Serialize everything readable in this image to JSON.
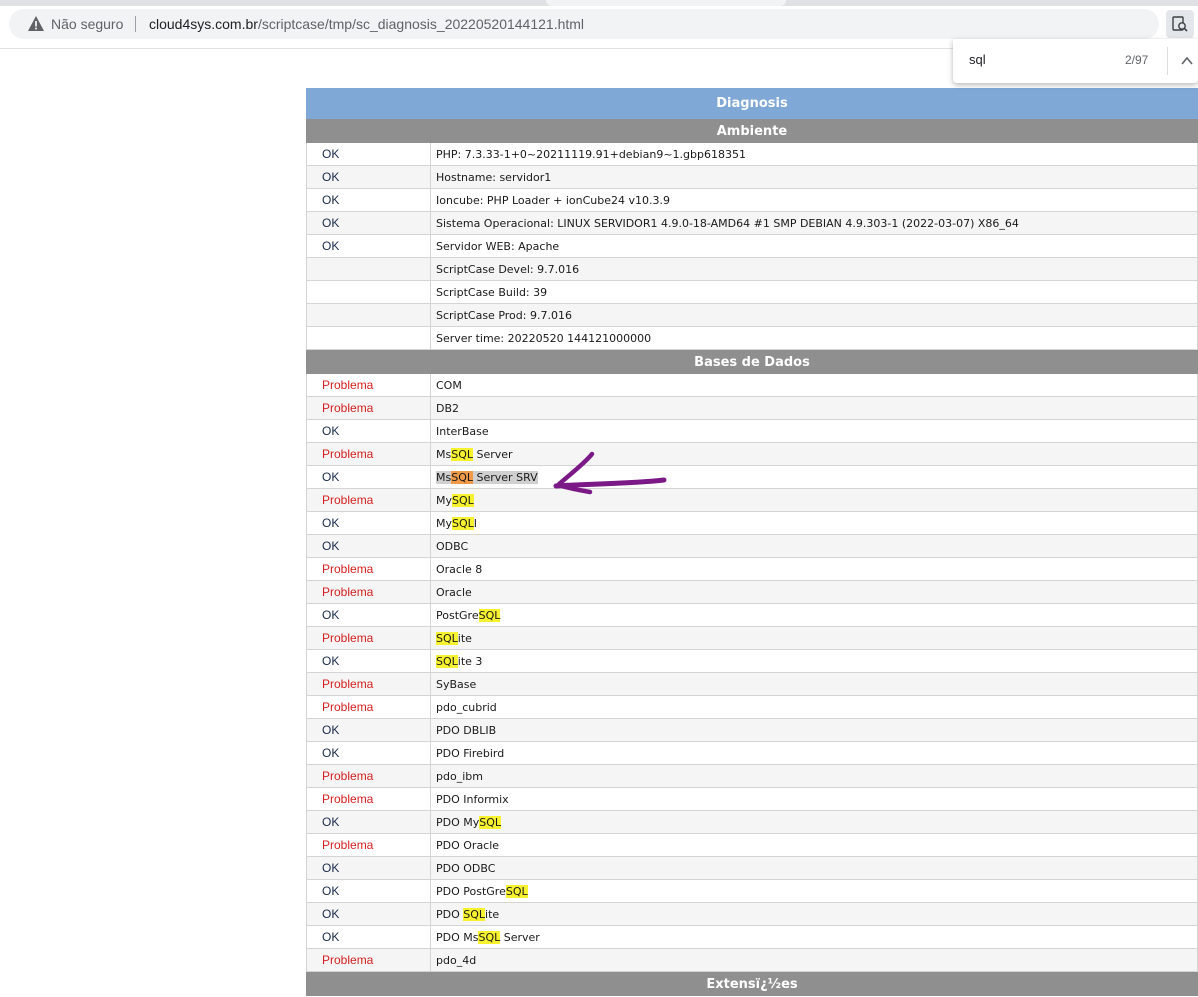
{
  "browser": {
    "security_label": "Não seguro",
    "url_host": "cloud4sys.com.br",
    "url_path": "/scriptcase/tmp/sc_diagnosis_20220520144121.html"
  },
  "find": {
    "query": "sql",
    "count": "2/97"
  },
  "table": {
    "title": "Diagnosis",
    "sections": [
      {
        "title": "Ambiente",
        "rows": [
          {
            "status": "OK",
            "desc": "PHP: 7.3.33-1+0~20211119.91+debian9~1.gbp618351"
          },
          {
            "status": "OK",
            "desc": "Hostname: servidor1"
          },
          {
            "status": "OK",
            "desc": "Ioncube: PHP Loader + ionCube24 v10.3.9"
          },
          {
            "status": "OK",
            "desc": "Sistema Operacional: LINUX SERVIDOR1 4.9.0-18-AMD64 #1 SMP DEBIAN 4.9.303-1 (2022-03-07) X86_64"
          },
          {
            "status": "OK",
            "desc": "Servidor WEB: Apache"
          },
          {
            "status": "",
            "desc": "ScriptCase Devel: 9.7.016"
          },
          {
            "status": "",
            "desc": "ScriptCase Build: 39"
          },
          {
            "status": "",
            "desc": "ScriptCase Prod: 9.7.016"
          },
          {
            "status": "",
            "desc": "Server time: 20220520 144121000000"
          }
        ]
      },
      {
        "title": "Bases de Dados",
        "rows": [
          {
            "status": "Problema",
            "desc": "COM"
          },
          {
            "status": "Problema",
            "desc": "DB2"
          },
          {
            "status": "OK",
            "desc": "InterBase"
          },
          {
            "status": "Problema",
            "desc": "MsSQL Server"
          },
          {
            "status": "OK",
            "desc": "MsSQL Server SRV"
          },
          {
            "status": "Problema",
            "desc": "MySQL"
          },
          {
            "status": "OK",
            "desc": "MySQLI"
          },
          {
            "status": "OK",
            "desc": "ODBC"
          },
          {
            "status": "Problema",
            "desc": "Oracle 8"
          },
          {
            "status": "Problema",
            "desc": "Oracle"
          },
          {
            "status": "OK",
            "desc": "PostGreSQL"
          },
          {
            "status": "Problema",
            "desc": "SQLite"
          },
          {
            "status": "OK",
            "desc": "SQLite 3"
          },
          {
            "status": "Problema",
            "desc": "SyBase"
          },
          {
            "status": "Problema",
            "desc": "pdo_cubrid"
          },
          {
            "status": "OK",
            "desc": "PDO DBLIB"
          },
          {
            "status": "OK",
            "desc": "PDO Firebird"
          },
          {
            "status": "Problema",
            "desc": "pdo_ibm"
          },
          {
            "status": "Problema",
            "desc": "PDO Informix"
          },
          {
            "status": "OK",
            "desc": "PDO MySQL"
          },
          {
            "status": "Problema",
            "desc": "PDO Oracle"
          },
          {
            "status": "OK",
            "desc": "PDO ODBC"
          },
          {
            "status": "OK",
            "desc": "PDO PostGreSQL"
          },
          {
            "status": "OK",
            "desc": "PDO SQLite"
          },
          {
            "status": "OK",
            "desc": "PDO MsSQL Server"
          },
          {
            "status": "Problema",
            "desc": "pdo_4d"
          }
        ]
      },
      {
        "title": "Extensï¿½es",
        "rows": []
      }
    ]
  },
  "colors": {
    "header_blue": "#7fa8d6",
    "section_gray": "#8f8f8f",
    "ok_text": "#1a2a4a",
    "problem_text": "#d42020",
    "find_highlight": "#f6f22f",
    "find_current": "#f09a4a",
    "annotation_arrow": "#7b1a86"
  }
}
